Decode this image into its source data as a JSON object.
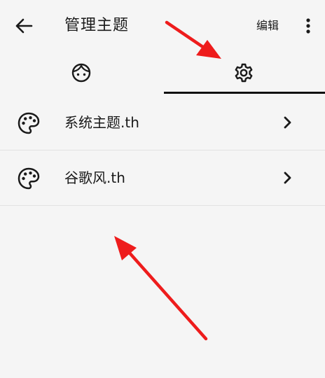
{
  "header": {
    "title": "管理主题",
    "edit_label": "编辑",
    "back_icon": "arrow-left-icon",
    "more_icon": "more-vertical-icon"
  },
  "tabs": [
    {
      "icon": "face-icon",
      "active": false
    },
    {
      "icon": "gear-icon",
      "active": true
    }
  ],
  "themes": [
    {
      "name": "系统主题.th",
      "icon": "palette-icon"
    },
    {
      "name": "谷歌风.th",
      "icon": "palette-icon"
    }
  ],
  "colors": {
    "background": "#f5f5f5",
    "text": "#1a1a1a",
    "tab_indicator": "#111111",
    "annotation_arrow": "#ee1c1c"
  }
}
